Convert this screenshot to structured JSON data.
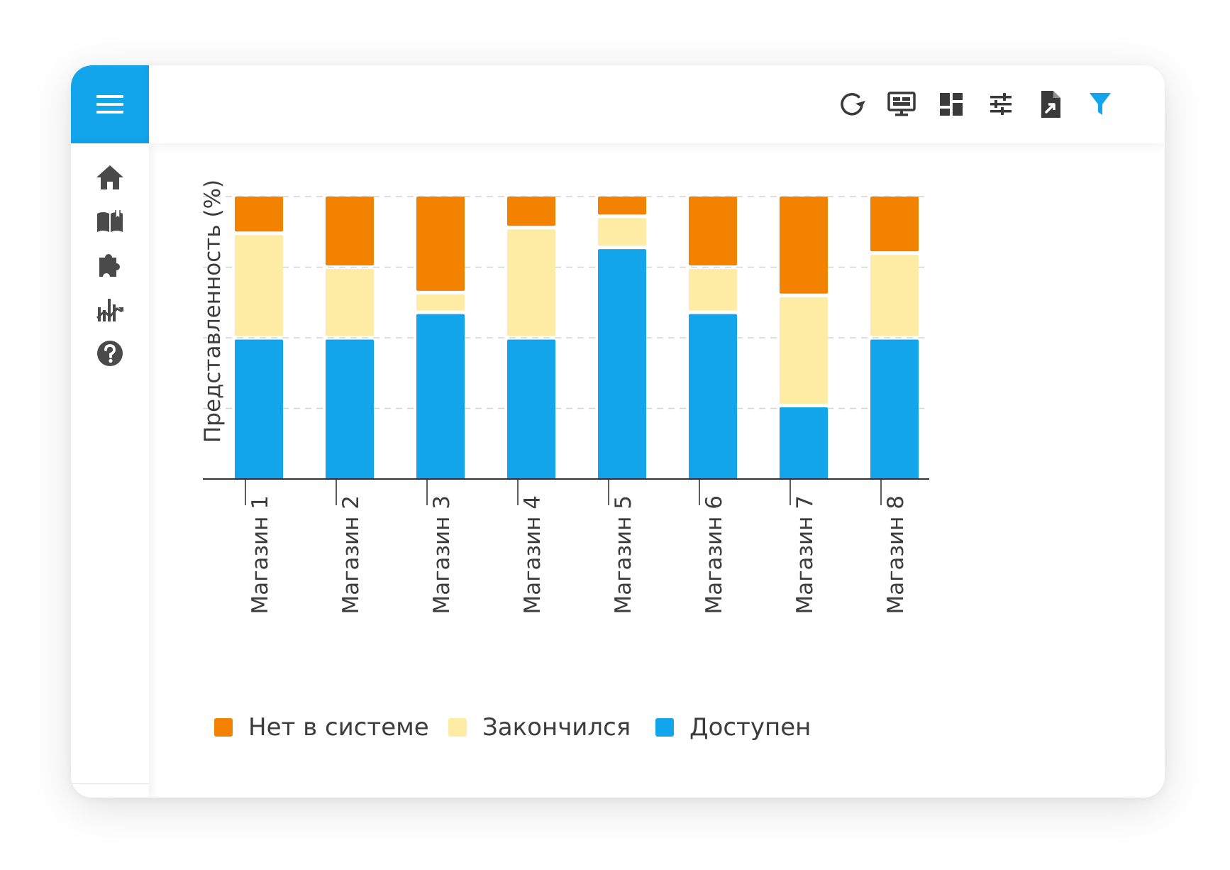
{
  "chart_data": {
    "type": "bar",
    "stacked": true,
    "categories": [
      "Магазин 1",
      "Магазин 2",
      "Магазин 3",
      "Магазин 4",
      "Магазин 5",
      "Магазин 6",
      "Магазин 7",
      "Магазин 8"
    ],
    "series": [
      {
        "name": "Доступен",
        "color": "#12a5eb",
        "values": [
          50,
          50,
          59,
          50,
          82,
          59,
          26,
          50
        ]
      },
      {
        "name": "Закончился",
        "color": "#feeba4",
        "values": [
          37,
          25,
          7,
          39,
          11,
          16,
          39,
          30
        ]
      },
      {
        "name": "Нет в системе",
        "color": "#f28200",
        "values": [
          13,
          25,
          34,
          11,
          7,
          25,
          35,
          20
        ]
      }
    ],
    "ylabel": "Представленность (%)",
    "xlabel": "",
    "ylim": [
      0,
      100
    ],
    "yticks": [
      0,
      25,
      50,
      75,
      100
    ],
    "ytick_labels_shown": false,
    "grid": true,
    "legend_position": "bottom-left",
    "legend_order": [
      "Нет в системе",
      "Закончился",
      "Доступен"
    ]
  },
  "colors": {
    "accent": "#12a5eb",
    "icon": "#3a3a3a",
    "sidebar_icon": "#4a4a4a",
    "filter_active": "#12a5eb"
  },
  "toolbar": {
    "icons": [
      "refresh-icon",
      "monitor-icon",
      "dashboard-icon",
      "sliders-icon",
      "export-file-icon",
      "filter-icon"
    ]
  },
  "sidebar": {
    "items": [
      "home-icon",
      "book-icon",
      "puzzle-icon",
      "analytics-icon",
      "help-icon"
    ],
    "footer": "mascot-logo"
  }
}
